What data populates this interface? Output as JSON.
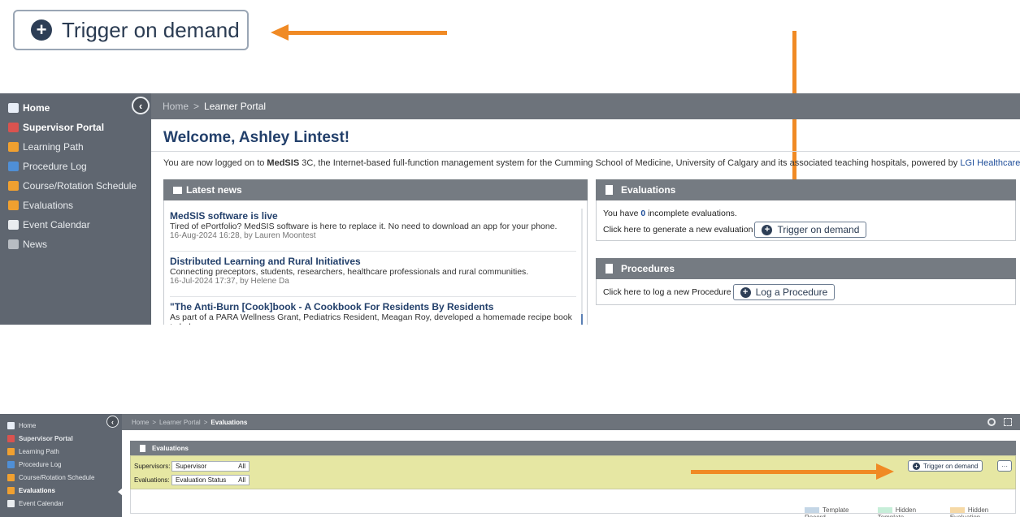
{
  "callout": {
    "label": "Trigger on demand"
  },
  "colors": {
    "arrow": "#f08a24",
    "sidebar": "#5f6670",
    "topbar": "#6d737b",
    "filter_bg": "#e6e7a3"
  },
  "screen1": {
    "sidebar": [
      {
        "label": "Home",
        "icon": "home-icon",
        "bold": true
      },
      {
        "label": "Supervisor Portal",
        "icon": "supervisor-icon",
        "bold": true
      },
      {
        "label": "Learning Path",
        "icon": "people-icon"
      },
      {
        "label": "Procedure Log",
        "icon": "procedure-icon"
      },
      {
        "label": "Course/Rotation Schedule",
        "icon": "people-icon"
      },
      {
        "label": "Evaluations",
        "icon": "people-icon"
      },
      {
        "label": "Event Calendar",
        "icon": "calendar-icon"
      },
      {
        "label": "News",
        "icon": "news-icon"
      }
    ],
    "breadcrumb": {
      "home": "Home",
      "sep": ">",
      "current": "Learner Portal"
    },
    "welcome": "Welcome, Ashley Lintest!",
    "intro": {
      "prefix": "You are now logged on to ",
      "brand": "MedSIS",
      "middle": " 3C, the Internet-based full-function management system for the Cumming School of Medicine, University of Calgary and its associated teaching hospitals, powered by ",
      "link": "LGI Healthcare Solutions Inc",
      "suffix": "."
    },
    "news": {
      "header": "Latest news",
      "items": [
        {
          "title": "MedSIS software is live",
          "summary": "Tired of ePortfolio? MedSIS software is here to replace it. No need to download an app for your phone.",
          "meta": "16-Aug-2024 16:28, by Lauren Moontest"
        },
        {
          "title": "Distributed Learning and Rural Initiatives",
          "summary": "Connecting preceptors, students, researchers, healthcare professionals and rural communities.",
          "meta": "16-Jul-2024 17:37, by Helene Da"
        },
        {
          "title": "\"The Anti-Burn [Cook]book - A Cookbook For Residents By Residents",
          "summary": "As part of a PARA Wellness Grant, Pediatrics Resident, Meagan Roy, developed a homemade recipe book to help",
          "meta": ""
        }
      ]
    },
    "evaluations": {
      "header": "Evaluations",
      "line1_prefix": "You have ",
      "count": "0",
      "line1_suffix": " incomplete evaluations.",
      "line2": "Click here to generate a new evaluation",
      "button": "Trigger on demand"
    },
    "procedures": {
      "header": "Procedures",
      "line": "Click here to log a new Procedure",
      "button": "Log a Procedure"
    }
  },
  "screen2": {
    "sidebar": [
      {
        "label": "Home",
        "icon": "home-icon"
      },
      {
        "label": "Supervisor Portal",
        "icon": "supervisor-icon",
        "bold": true
      },
      {
        "label": "Learning Path",
        "icon": "people-icon"
      },
      {
        "label": "Procedure Log",
        "icon": "procedure-icon"
      },
      {
        "label": "Course/Rotation Schedule",
        "icon": "people-icon"
      },
      {
        "label": "Evaluations",
        "icon": "people-icon",
        "bold": true
      },
      {
        "label": "Event Calendar",
        "icon": "calendar-icon"
      }
    ],
    "breadcrumb": {
      "home": "Home",
      "sep": ">",
      "mid": "Learner Portal",
      "current": "Evaluations"
    },
    "panel_header": "Evaluations",
    "filters": [
      {
        "label": "Supervisors:",
        "value": "Supervisor",
        "all": "All"
      },
      {
        "label": "Evaluations:",
        "value": "Evaluation Status",
        "all": "All"
      }
    ],
    "trigger_button": "Trigger on demand",
    "more_button": "···",
    "legend": [
      {
        "label": "Template Record",
        "color": "#c4d6e6"
      },
      {
        "label": "Hidden Template",
        "color": "#c7eed9"
      },
      {
        "label": "Hidden Evaluation",
        "color": "#f6d9a6"
      }
    ]
  }
}
